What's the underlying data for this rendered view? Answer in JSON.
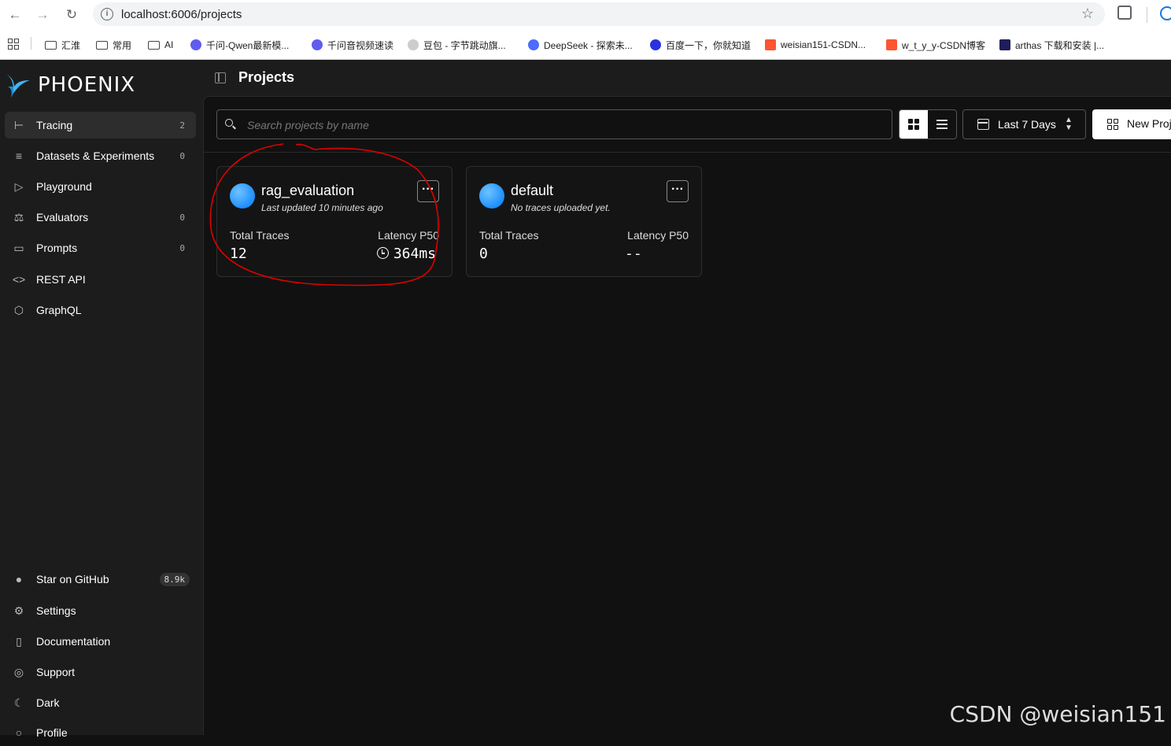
{
  "browser": {
    "url": "localhost:6006/projects",
    "bookmarks": [
      "汇淮",
      "常用",
      "AI",
      "千问-Qwen最新模...",
      "千问音视频速读",
      "豆包 - 字节跳动旗...",
      "DeepSeek - 探索未...",
      "百度一下，你就知道",
      "weisian151-CSDN...",
      "w_t_y_y-CSDN博客",
      "arthas 下载和安装 |..."
    ],
    "bookmark_colors": {
      "qwen": "#615ced",
      "deepseek": "#4d6bfe",
      "baidu": "#2932e1",
      "csdn": "#fc5531",
      "arthas": "#1e1e5a"
    }
  },
  "logo": {
    "text": "PHOENIX"
  },
  "sidebar": {
    "items": [
      {
        "label": "Tracing",
        "count": "2",
        "icon": "tracing-icon"
      },
      {
        "label": "Datasets & Experiments",
        "count": "0",
        "icon": "database-icon"
      },
      {
        "label": "Playground",
        "count": "",
        "icon": "play-icon"
      },
      {
        "label": "Evaluators",
        "count": "0",
        "icon": "scale-icon"
      },
      {
        "label": "Prompts",
        "count": "0",
        "icon": "message-icon"
      },
      {
        "label": "REST API",
        "count": "",
        "icon": "code-icon"
      },
      {
        "label": "GraphQL",
        "count": "",
        "icon": "graphql-icon"
      }
    ],
    "bottom": [
      {
        "label": "Star on GitHub",
        "badge": "8.9k",
        "icon": "github-icon"
      },
      {
        "label": "Settings",
        "icon": "gear-icon"
      },
      {
        "label": "Documentation",
        "icon": "book-icon"
      },
      {
        "label": "Support",
        "icon": "lifebuoy-icon"
      },
      {
        "label": "Dark",
        "icon": "moon-icon"
      },
      {
        "label": "Profile",
        "icon": "user-icon"
      }
    ]
  },
  "header": {
    "title": "Projects"
  },
  "toolbar": {
    "search_placeholder": "Search projects by name",
    "date_range": "Last 7 Days",
    "new_project": "New Proj"
  },
  "projects": [
    {
      "name": "rag_evaluation",
      "subtitle": "Last updated 10 minutes ago",
      "total_traces_label": "Total Traces",
      "total_traces": "12",
      "latency_label": "Latency P50",
      "latency": "364ms"
    },
    {
      "name": "default",
      "subtitle": "No traces uploaded yet.",
      "total_traces_label": "Total Traces",
      "total_traces": "0",
      "latency_label": "Latency P50",
      "latency": "--"
    }
  ],
  "watermark": "CSDN @weisian151",
  "colors": {
    "accent": "#1d8fff",
    "annotation": "#e00000"
  }
}
